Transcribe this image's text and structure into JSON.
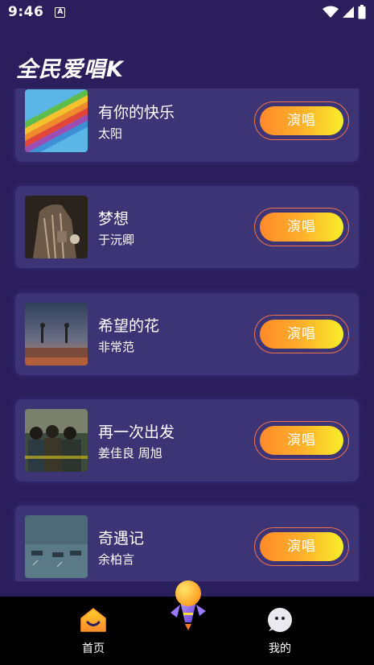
{
  "status_bar": {
    "time": "9:46",
    "notif_icon": "A"
  },
  "header": {
    "title": "全民爱唱K"
  },
  "songs": [
    {
      "title": "有你的快乐",
      "artist": "太阳",
      "action": "演唱"
    },
    {
      "title": "梦想",
      "artist": "于沅卿",
      "action": "演唱"
    },
    {
      "title": "希望的花",
      "artist": "非常范",
      "action": "演唱"
    },
    {
      "title": "再一次出发",
      "artist": "姜佳良 周旭",
      "action": "演唱"
    },
    {
      "title": "奇遇记",
      "artist": "余柏言",
      "action": "演唱"
    }
  ],
  "nav": {
    "home": "首页",
    "mine": "我的"
  },
  "colors": {
    "background": "#2b1e5c",
    "card": "#3c3474",
    "button_start": "#ff8a2a",
    "button_end": "#f6ee2a",
    "nav_bg": "#000000"
  }
}
